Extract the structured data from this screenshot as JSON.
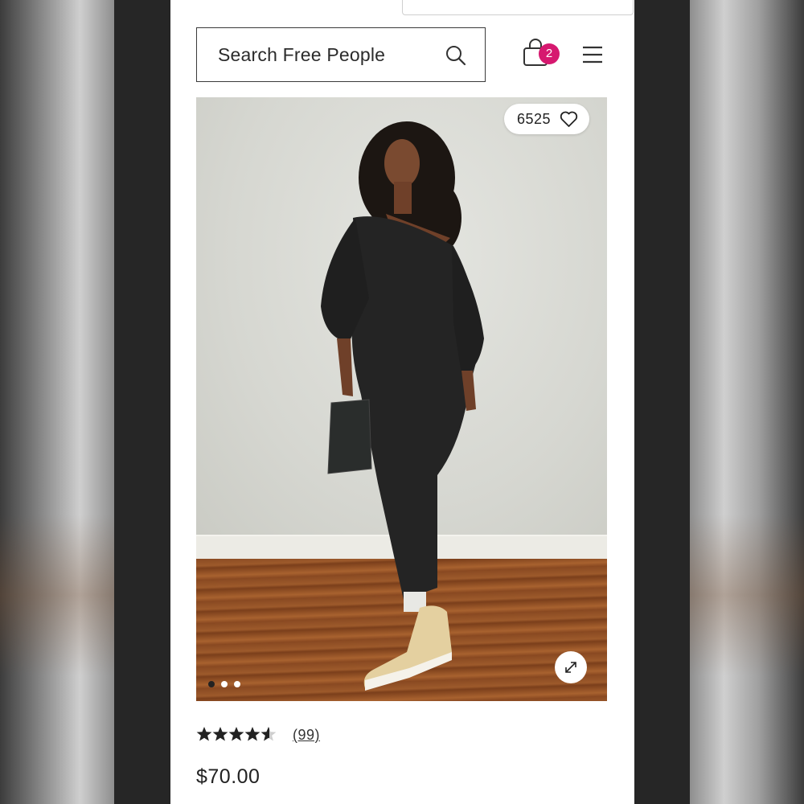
{
  "header": {
    "search": {
      "placeholder": "Search Free People",
      "icon": "search-icon"
    },
    "bag": {
      "icon": "shopping-bag-icon",
      "count": "2",
      "badge_color": "#d6186f"
    },
    "menu": {
      "icon": "hamburger-menu-icon"
    }
  },
  "product": {
    "image": {
      "likes": "6525",
      "like_icon": "heart-icon",
      "expand_icon": "expand-icon",
      "carousel": {
        "total": 3,
        "active_index": 0
      }
    },
    "rating": {
      "stars": 4.5,
      "max_stars": 5,
      "reviews": "(99)"
    },
    "price": "$70.00"
  }
}
